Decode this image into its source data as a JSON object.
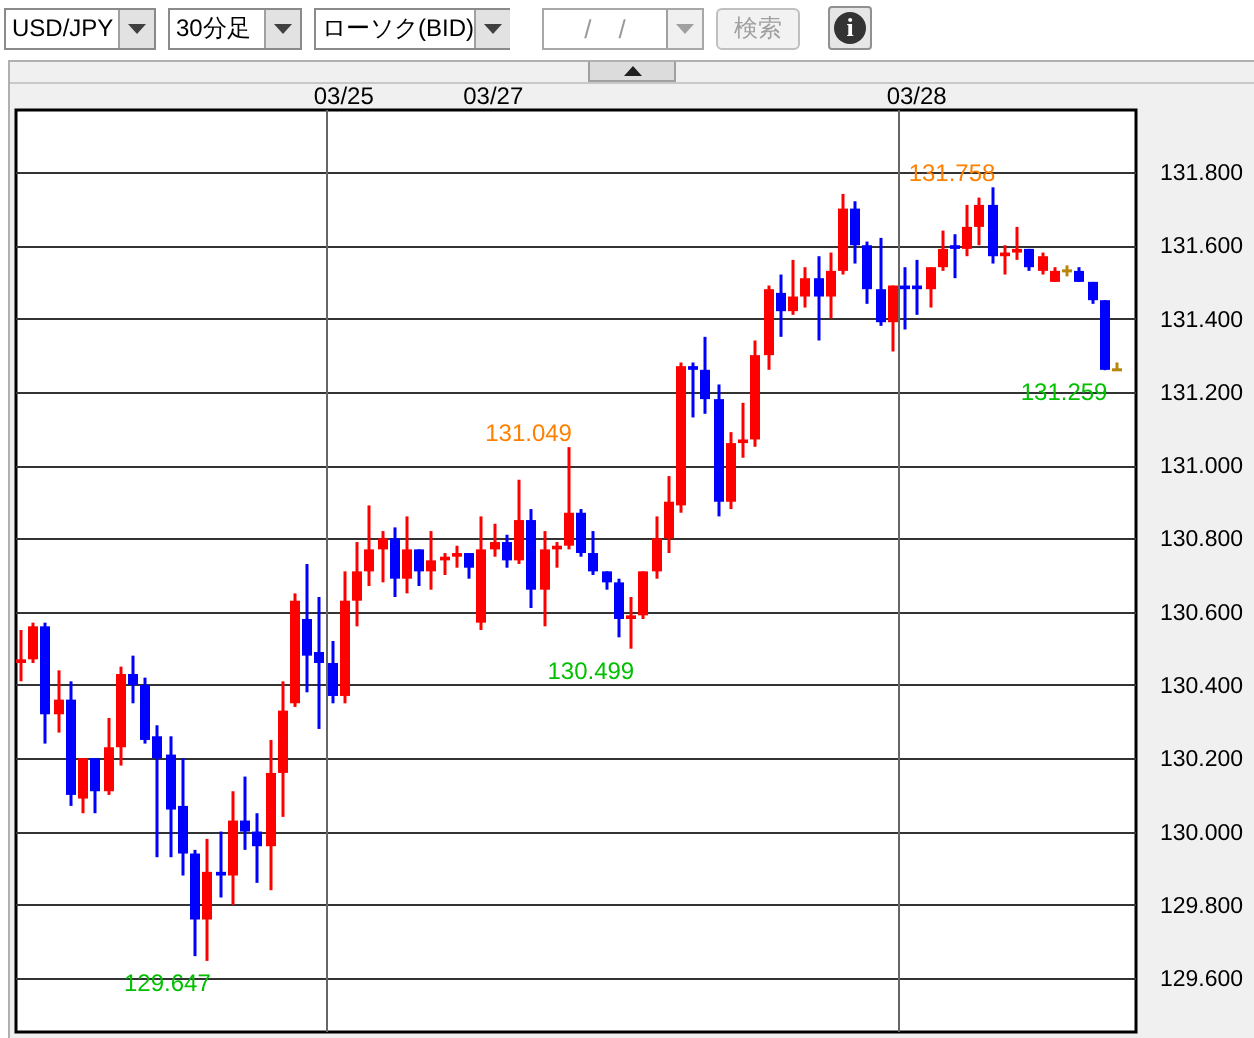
{
  "toolbar": {
    "selects": [
      {
        "value": "USD/JPY"
      },
      {
        "value": "30分足"
      },
      {
        "value": "ローソク(BID)"
      }
    ],
    "date_field": {
      "placeholder": "/ /",
      "disabled": true
    },
    "search_button": {
      "label": "検索",
      "disabled": true
    },
    "info_button": {
      "label": "i"
    }
  },
  "chart": {
    "collapse_button": {
      "expanded": true
    },
    "chart_data": {
      "type": "candlestick",
      "grid": true,
      "categories": [
        null,
        null,
        null,
        null,
        null,
        null,
        null,
        null,
        null,
        null,
        null,
        null,
        null,
        null,
        null,
        null,
        null,
        null,
        null,
        null,
        null,
        null,
        null,
        null,
        null,
        null,
        "03/25",
        null,
        null,
        null,
        null,
        null,
        null,
        null,
        null,
        null,
        null,
        null,
        "03/27",
        null,
        null,
        null,
        null,
        null,
        null,
        null,
        null,
        null,
        null,
        null,
        null,
        null,
        null,
        null,
        null,
        null,
        null,
        null,
        null,
        null,
        null,
        null,
        null,
        null,
        null,
        null,
        null,
        null,
        null,
        null,
        null,
        null,
        "03/28",
        null,
        null,
        null,
        null,
        null,
        null,
        null,
        null,
        null,
        null,
        null,
        null,
        null,
        null,
        null,
        null
      ],
      "ylim": [
        129.453,
        131.969
      ],
      "yticks": [
        {
          "value": 129.6,
          "label": "129.600"
        },
        {
          "value": 129.8,
          "label": "129.800"
        },
        {
          "value": 130.0,
          "label": "130.000"
        },
        {
          "value": 130.2,
          "label": "130.200"
        },
        {
          "value": 130.4,
          "label": "130.400"
        },
        {
          "value": 130.6,
          "label": "130.600"
        },
        {
          "value": 130.8,
          "label": "130.800"
        },
        {
          "value": 131.0,
          "label": "131.000"
        },
        {
          "value": 131.2,
          "label": "131.200"
        },
        {
          "value": 131.4,
          "label": "131.400"
        },
        {
          "value": 131.6,
          "label": "131.600"
        },
        {
          "value": 131.8,
          "label": "131.800"
        }
      ],
      "ohlc": [
        [
          130.46,
          130.55,
          130.41,
          130.47
        ],
        [
          130.47,
          130.57,
          130.46,
          130.56
        ],
        [
          130.56,
          130.57,
          130.24,
          130.32
        ],
        [
          130.32,
          130.44,
          130.27,
          130.36
        ],
        [
          130.36,
          130.41,
          130.07,
          130.1
        ],
        [
          130.09,
          130.2,
          130.05,
          130.2
        ],
        [
          130.2,
          130.2,
          130.05,
          130.11
        ],
        [
          130.11,
          130.31,
          130.1,
          130.23
        ],
        [
          130.23,
          130.45,
          130.18,
          130.43
        ],
        [
          130.43,
          130.48,
          130.35,
          130.4
        ],
        [
          130.4,
          130.42,
          130.24,
          130.25
        ],
        [
          130.26,
          130.29,
          129.93,
          130.2
        ],
        [
          130.21,
          130.26,
          129.93,
          130.06
        ],
        [
          130.07,
          130.2,
          129.88,
          129.94
        ],
        [
          129.94,
          129.95,
          129.66,
          129.76
        ],
        [
          129.76,
          129.98,
          129.647,
          129.89
        ],
        [
          129.89,
          130.0,
          129.82,
          129.88
        ],
        [
          129.88,
          130.11,
          129.8,
          130.03
        ],
        [
          130.03,
          130.15,
          129.95,
          130.0
        ],
        [
          130.0,
          130.05,
          129.86,
          129.96
        ],
        [
          129.96,
          130.25,
          129.84,
          130.16
        ],
        [
          130.16,
          130.41,
          130.04,
          130.33
        ],
        [
          130.35,
          130.65,
          130.34,
          130.63
        ],
        [
          130.58,
          130.73,
          130.38,
          130.48
        ],
        [
          130.49,
          130.64,
          130.28,
          130.46
        ],
        [
          130.46,
          130.52,
          130.35,
          130.37
        ],
        [
          130.37,
          130.71,
          130.35,
          130.63
        ],
        [
          130.63,
          130.79,
          130.56,
          130.71
        ],
        [
          130.71,
          130.89,
          130.67,
          130.77
        ],
        [
          130.77,
          130.82,
          130.68,
          130.8
        ],
        [
          130.8,
          130.83,
          130.64,
          130.69
        ],
        [
          130.69,
          130.86,
          130.65,
          130.77
        ],
        [
          130.77,
          130.77,
          130.67,
          130.71
        ],
        [
          130.71,
          130.82,
          130.66,
          130.74
        ],
        [
          130.74,
          130.76,
          130.7,
          130.75
        ],
        [
          130.75,
          130.78,
          130.72,
          130.76
        ],
        [
          130.76,
          130.76,
          130.69,
          130.72
        ],
        [
          130.57,
          130.86,
          130.55,
          130.77
        ],
        [
          130.77,
          130.84,
          130.75,
          130.79
        ],
        [
          130.79,
          130.81,
          130.72,
          130.74
        ],
        [
          130.74,
          130.96,
          130.73,
          130.85
        ],
        [
          130.85,
          130.88,
          130.61,
          130.66
        ],
        [
          130.66,
          130.82,
          130.56,
          130.77
        ],
        [
          130.77,
          130.79,
          130.72,
          130.78
        ],
        [
          130.78,
          131.049,
          130.77,
          130.87
        ],
        [
          130.87,
          130.88,
          130.75,
          130.76
        ],
        [
          130.76,
          130.82,
          130.7,
          130.71
        ],
        [
          130.71,
          130.71,
          130.66,
          130.68
        ],
        [
          130.68,
          130.69,
          130.53,
          130.58
        ],
        [
          130.58,
          130.64,
          130.499,
          130.59
        ],
        [
          130.59,
          130.71,
          130.58,
          130.71
        ],
        [
          130.71,
          130.86,
          130.69,
          130.8
        ],
        [
          130.8,
          130.97,
          130.76,
          130.9
        ],
        [
          130.89,
          131.28,
          130.87,
          131.27
        ],
        [
          131.27,
          131.28,
          131.13,
          131.26
        ],
        [
          131.26,
          131.35,
          131.14,
          131.18
        ],
        [
          131.18,
          131.22,
          130.86,
          130.9
        ],
        [
          130.9,
          131.09,
          130.88,
          131.06
        ],
        [
          131.06,
          131.17,
          131.02,
          131.07
        ],
        [
          131.07,
          131.34,
          131.05,
          131.3
        ],
        [
          131.3,
          131.49,
          131.26,
          131.48
        ],
        [
          131.47,
          131.52,
          131.35,
          131.42
        ],
        [
          131.42,
          131.56,
          131.41,
          131.46
        ],
        [
          131.46,
          131.54,
          131.43,
          131.51
        ],
        [
          131.51,
          131.57,
          131.34,
          131.46
        ],
        [
          131.46,
          131.58,
          131.4,
          131.53
        ],
        [
          131.53,
          131.74,
          131.52,
          131.7
        ],
        [
          131.7,
          131.72,
          131.55,
          131.6
        ],
        [
          131.6,
          131.61,
          131.44,
          131.48
        ],
        [
          131.48,
          131.62,
          131.38,
          131.39
        ],
        [
          131.39,
          131.49,
          131.31,
          131.49
        ],
        [
          131.49,
          131.54,
          131.37,
          131.48
        ],
        [
          131.49,
          131.56,
          131.41,
          131.48
        ],
        [
          131.48,
          131.54,
          131.43,
          131.54
        ],
        [
          131.54,
          131.64,
          131.53,
          131.59
        ],
        [
          131.6,
          131.63,
          131.51,
          131.59
        ],
        [
          131.59,
          131.71,
          131.57,
          131.65
        ],
        [
          131.65,
          131.73,
          131.6,
          131.71
        ],
        [
          131.71,
          131.758,
          131.55,
          131.57
        ],
        [
          131.57,
          131.6,
          131.52,
          131.58
        ],
        [
          131.58,
          131.65,
          131.56,
          131.59
        ],
        [
          131.59,
          131.59,
          131.53,
          131.54
        ],
        [
          131.53,
          131.58,
          131.52,
          131.57
        ],
        [
          131.5,
          131.54,
          131.5,
          131.53
        ],
        [
          131.53,
          131.545,
          131.515,
          131.53
        ],
        [
          131.53,
          131.54,
          131.5,
          131.5
        ],
        [
          131.5,
          131.5,
          131.44,
          131.45
        ],
        [
          131.45,
          131.45,
          131.259,
          131.26
        ],
        [
          131.26,
          131.28,
          131.26,
          131.26
        ]
      ],
      "annotations": [
        "129.647",
        "131.049",
        "130.499",
        "131.758",
        "131.259"
      ]
    }
  }
}
